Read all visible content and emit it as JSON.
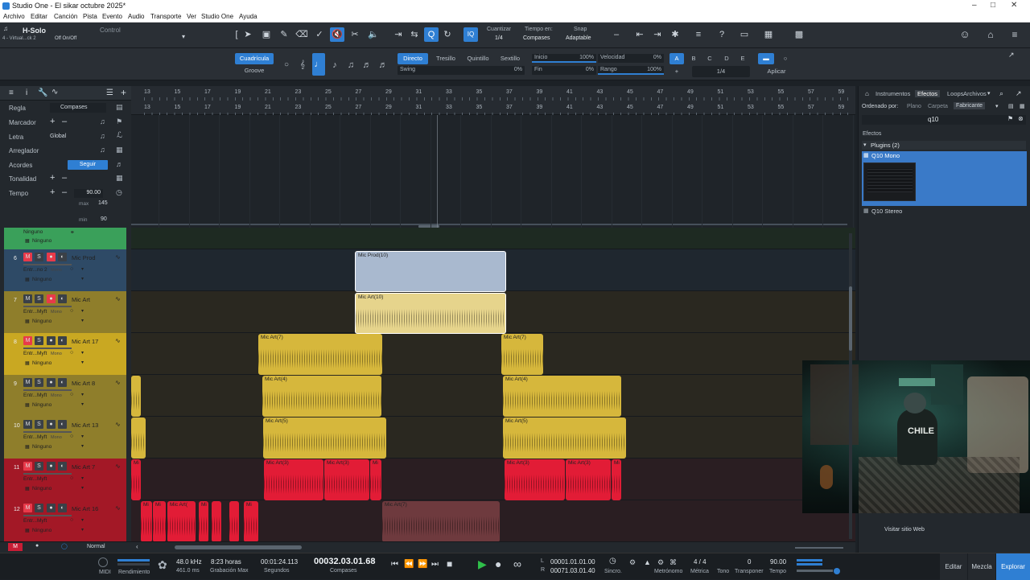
{
  "window": {
    "title": "Studio One - El sikar octubre 2025*"
  },
  "menu": [
    "Archivo",
    "Editar",
    "Canción",
    "Pista",
    "Evento",
    "Audio",
    "Transporte",
    "Ver",
    "Studio One",
    "Ayuda"
  ],
  "toolbar": {
    "track_label": "H-Solo",
    "track_sub": "4 - Virtual...ck 2",
    "control_label": "Control",
    "onoff_label": "Off On/Off",
    "quantize_label": "Cuantizar",
    "quantize_value": "1/4",
    "timebase_label": "Tiempo en:",
    "timebase_value": "Compases",
    "snap_label": "Snap",
    "snap_value": "Adaptable",
    "iq_label": "IQ"
  },
  "quantize": {
    "grid_btn": "Cuadrícula",
    "groove_btn": "Groove",
    "directo": "Directo",
    "tresillo": "Tresillo",
    "quintillo": "Quintillo",
    "sextillo": "Sextillo",
    "swing_label": "Swing",
    "swing_value": "0%",
    "inicio_label": "Inicio",
    "inicio_value": "100%",
    "fin_label": "Fin",
    "fin_value": "0%",
    "velocidad_label": "Velocidad",
    "velocidad_value": "0%",
    "rango_label": "Rango",
    "rango_value": "100%",
    "letters": [
      "A",
      "B",
      "C",
      "D",
      "E"
    ],
    "plus": "+",
    "fraction": "1/4",
    "apply": "Aplicar"
  },
  "global_tracks": {
    "regla": "Regla",
    "regla_value": "Compases",
    "marcador": "Marcador",
    "letra": "Letra",
    "letra_value": "Global",
    "arreglador": "Arreglador",
    "acordes": "Acordes",
    "acordes_btn": "Seguir",
    "tonalidad": "Tonalidad",
    "tempo": "Tempo",
    "tempo_value": "90.00",
    "max_label": "max",
    "max_value": "145",
    "min_label": "min",
    "min_value": "90"
  },
  "tracks": [
    {
      "num": "",
      "name": "Ninguno",
      "sub1": "",
      "sub2": "Ninguno",
      "color": "#3aa05a"
    },
    {
      "num": "6",
      "name": "Mic Prod",
      "sub1": "Entr...no 2",
      "sub1b": "Mono",
      "sub2": "Ninguno",
      "color": "#2e4a66"
    },
    {
      "num": "7",
      "name": "Mic Art",
      "sub1": "Entr...Myft",
      "sub1b": "Mono",
      "sub2": "Ninguno",
      "color": "#8f7e2b"
    },
    {
      "num": "8",
      "name": "Mic Art 17",
      "sub1": "Entr...Myft",
      "sub1b": "Mono",
      "sub2": "Ninguno",
      "color": "#c9a822"
    },
    {
      "num": "9",
      "name": "Mic Art 8",
      "sub1": "Entr...Myft",
      "sub1b": "Mono",
      "sub2": "Ninguno",
      "color": "#8f7e2b"
    },
    {
      "num": "10",
      "name": "Mic Art 13",
      "sub1": "Entr...Myft",
      "sub1b": "Mono",
      "sub2": "Ninguno",
      "color": "#8f7e2b"
    },
    {
      "num": "11",
      "name": "Mic Art 7",
      "sub1": "Entr...Myft",
      "sub1b": "",
      "sub2": "Ninguno",
      "color": "#a31826"
    },
    {
      "num": "12",
      "name": "Mic Art 16",
      "sub1": "Entr...Myft",
      "sub1b": "",
      "sub2": "Ninguno",
      "color": "#a31826"
    }
  ],
  "track_btns": {
    "m": "M",
    "s": "S"
  },
  "ruler_ticks": [
    "13",
    "15",
    "17",
    "19",
    "21",
    "23",
    "25",
    "27",
    "29",
    "31",
    "33",
    "35",
    "37",
    "39",
    "41",
    "43",
    "45",
    "47",
    "49",
    "51",
    "53",
    "55",
    "57",
    "59"
  ],
  "clips": {
    "prod": "Mic Prod(10)",
    "art10": "Mic Art(10)",
    "art7": "Mic Art(7)",
    "art4": "Mic Art(4)",
    "art5": "Mic Art(5)",
    "art3": "Mic Art(3)",
    "mi": "Mi",
    "mic_art": "Mic Art("
  },
  "browser": {
    "tabs": [
      "Instrumentos",
      "Efectos",
      "Loops",
      "Archivos"
    ],
    "ordenado": "Ordenado por:",
    "sort_opts": [
      "Plano",
      "Carpeta",
      "Fabricante"
    ],
    "search": "q10",
    "section": "Efectos",
    "group": "Plugins (2)",
    "item1": "Q10 Mono",
    "item2": "Q10 Stereo",
    "visit": "Visitar sitio Web"
  },
  "statusbar": {
    "m": "M",
    "normal": "Normal"
  },
  "transport": {
    "midi": "MIDI",
    "rendimiento": "Rendimiento",
    "khz": "48.0 kHz",
    "ms": "461.0 ms",
    "horas": "8:23 horas",
    "grab_max": "Grabación Max",
    "time": "00:01:24.113",
    "segundos": "Segundos",
    "position": "00032.03.01.68",
    "compases": "Compases",
    "l_label": "L",
    "r_label": "R",
    "loop_start": "00001.01.01.00",
    "loop_end": "00071.03.01.40",
    "sincro": "Sincro.",
    "metronomo": "Metrónomo",
    "metrica": "Métrica",
    "metrica_value": "4 / 4",
    "tono": "Tono",
    "transponer": "Transponer",
    "transponer_value": "0",
    "tempo": "Tempo",
    "tempo_value": "90.00",
    "editar": "Editar",
    "mezcla": "Mezcla",
    "explorar": "Explorar"
  },
  "webcam": {
    "shirt": "CHILE"
  }
}
